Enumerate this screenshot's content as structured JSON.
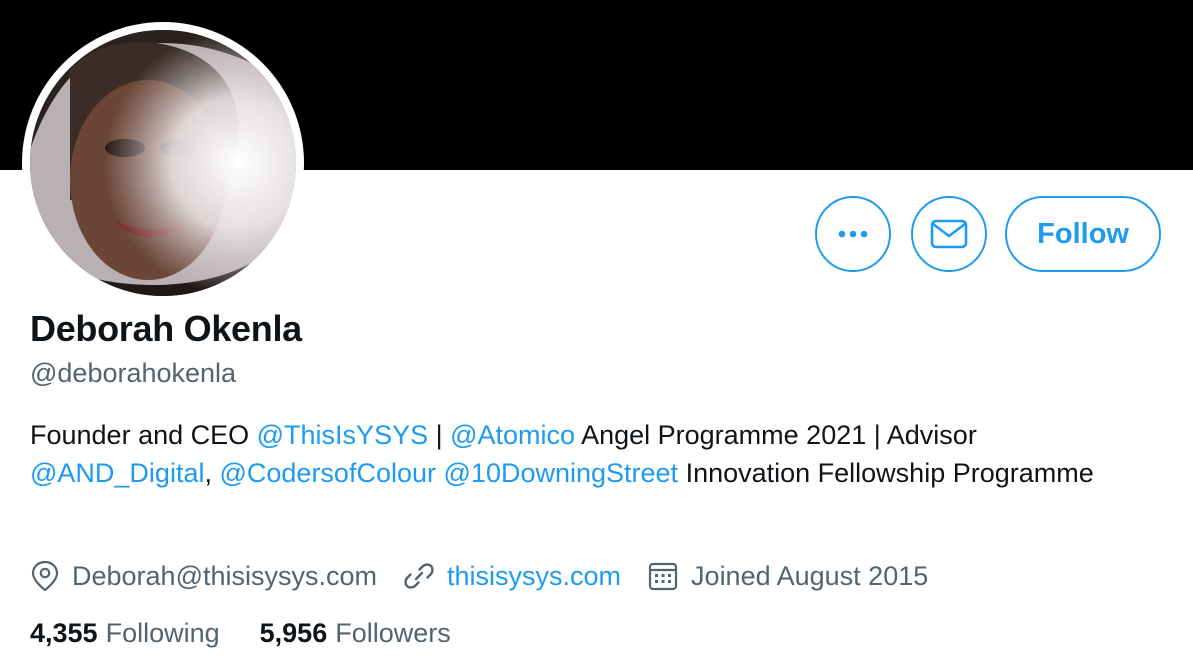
{
  "profile": {
    "name": "Deborah Okenla",
    "handle": "@deborahokenla"
  },
  "actions": {
    "more_icon": "more-horizontal-icon",
    "message_icon": "envelope-icon",
    "follow_label": "Follow"
  },
  "bio": {
    "segments": [
      {
        "text": "Founder and CEO ",
        "type": "text"
      },
      {
        "text": "@ThisIsYSYS",
        "type": "mention"
      },
      {
        "text": " | ",
        "type": "text"
      },
      {
        "text": "@Atomico",
        "type": "mention"
      },
      {
        "text": " Angel Programme 2021 | Advisor ",
        "type": "text"
      },
      {
        "text": "@AND_Digital",
        "type": "mention"
      },
      {
        "text": ", ",
        "type": "text"
      },
      {
        "text": "@CodersofColour",
        "type": "mention"
      },
      {
        "text": " ",
        "type": "text"
      },
      {
        "text": "@10DowningStreet",
        "type": "mention"
      },
      {
        "text": " Innovation Fellowship Programme",
        "type": "text"
      }
    ]
  },
  "meta": {
    "location": "Deborah@thisisysys.com",
    "location_icon": "location-pin-icon",
    "website": "thisisysys.com",
    "website_icon": "link-icon",
    "joined": "Joined August 2015",
    "joined_icon": "calendar-icon"
  },
  "stats": {
    "following_count": "4,355",
    "following_label": "Following",
    "followers_count": "5,956",
    "followers_label": "Followers"
  },
  "colors": {
    "accent": "#1d9bf0",
    "text_primary": "#0f1419",
    "text_secondary": "#536471",
    "banner": "#000000"
  }
}
